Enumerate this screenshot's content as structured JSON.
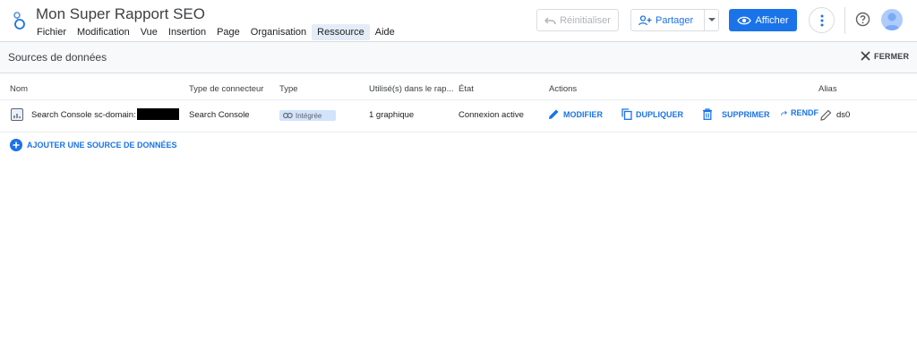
{
  "header": {
    "title": "Mon Super Rapport SEO",
    "menu": [
      "Fichier",
      "Modification",
      "Vue",
      "Insertion",
      "Page",
      "Organisation",
      "Ressource",
      "Aide"
    ],
    "active_menu": "Ressource",
    "reset_label": "Réinitialiser",
    "share_label": "Partager",
    "view_label": "Afficher"
  },
  "panel": {
    "title": "Sources de données",
    "close_label": "FERMER"
  },
  "table": {
    "headers": {
      "name": "Nom",
      "connector": "Type de connecteur",
      "type": "Type",
      "used": "Utilisé(s) dans le rap...",
      "state": "État",
      "actions": "Actions",
      "alias": "Alias"
    },
    "rows": [
      {
        "name": "Search Console sc-domain:",
        "connector": "Search Console",
        "type": "Intégrée",
        "used": "1 graphique",
        "state": "Connexion active",
        "alias": "ds0"
      }
    ],
    "actions": {
      "edit": "MODIFIER",
      "duplicate": "DUPLIQUER",
      "delete": "SUPPRIMER",
      "render": "RENDF"
    }
  },
  "add_source_label": "AJOUTER UNE SOURCE DE DONNÉES",
  "colors": {
    "accent": "#1a73e8",
    "panel_bg": "#f8f9fa",
    "active_menu_bg": "#e3ecf7",
    "chip_bg": "#d2e3fc"
  }
}
